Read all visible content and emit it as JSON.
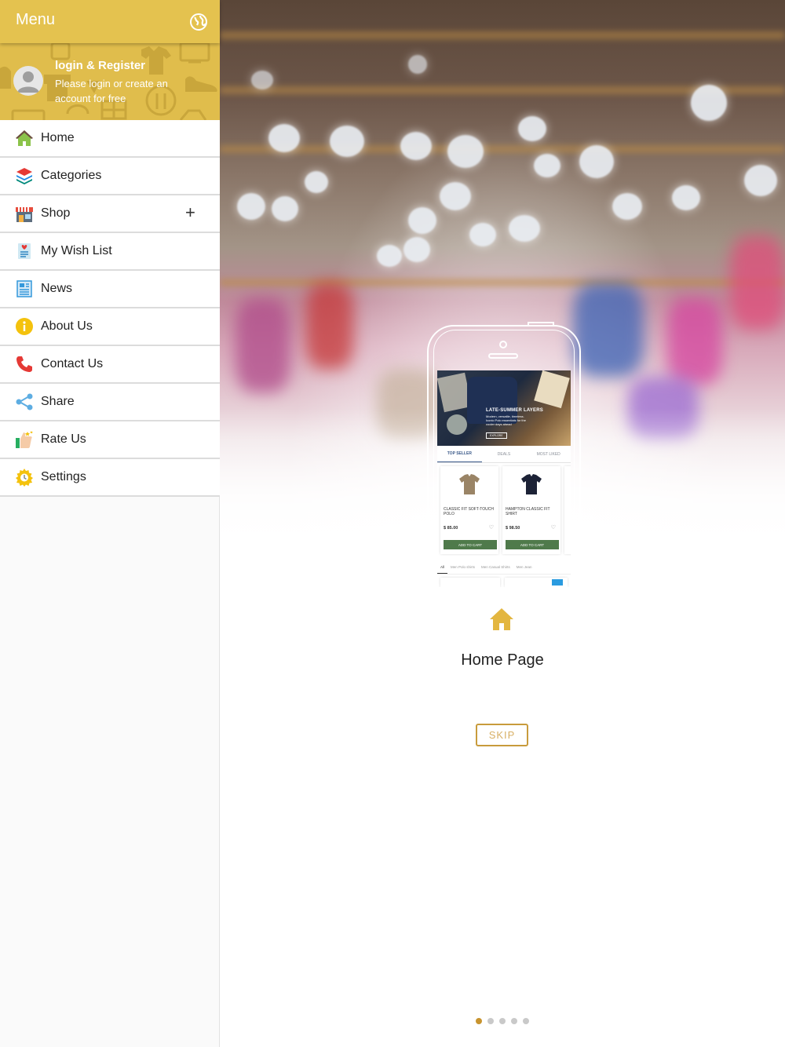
{
  "drawer": {
    "title": "Menu",
    "language_icon": "globe-icon",
    "profile": {
      "title": "login & Register",
      "subtitle": "Please login or create an account for free",
      "avatar_icon": "user-avatar-icon"
    },
    "items": [
      {
        "label": "Home",
        "icon": "home-icon"
      },
      {
        "label": "Categories",
        "icon": "layers-icon"
      },
      {
        "label": "Shop",
        "icon": "shop-icon",
        "expand": "+"
      },
      {
        "label": "My Wish List",
        "icon": "wishlist-icon"
      },
      {
        "label": "News",
        "icon": "newspaper-icon"
      },
      {
        "label": "About Us",
        "icon": "info-icon"
      },
      {
        "label": "Contact Us",
        "icon": "phone-icon"
      },
      {
        "label": "Share",
        "icon": "share-icon"
      },
      {
        "label": "Rate Us",
        "icon": "rate-icon"
      },
      {
        "label": "Settings",
        "icon": "settings-icon"
      }
    ]
  },
  "onboarding": {
    "mockup": {
      "hero_title": "LATE-SUMMER LAYERS",
      "hero_subtitle": "Modern, versatile, timeless. Iconic Polo essentials for the cooler days ahead",
      "hero_button": "EXPLORE",
      "tabs": [
        "TOP SELLER",
        "DEALS",
        "MOST LIKED"
      ],
      "products": [
        {
          "name": "CLASSIC FIT SOFT-TOUCH POLO",
          "price": "$ 85.00",
          "cart": "ADD TO CART"
        },
        {
          "name": "HAMPTON CLASSIC FIT SHIRT",
          "price": "$ 98.50",
          "cart": "ADD TO CART"
        }
      ],
      "categories": [
        "All",
        "Men Polo shirts",
        "Men Casual Shirts",
        "Men Jean"
      ]
    },
    "slide_icon": "home-icon",
    "slide_title": "Home Page",
    "skip_label": "SKIP",
    "pager": {
      "total": 5,
      "active_index": 0
    }
  },
  "colors": {
    "accent": "#e4c24f",
    "skip_border": "#c89b3c",
    "pager_active": "#c8942f"
  }
}
